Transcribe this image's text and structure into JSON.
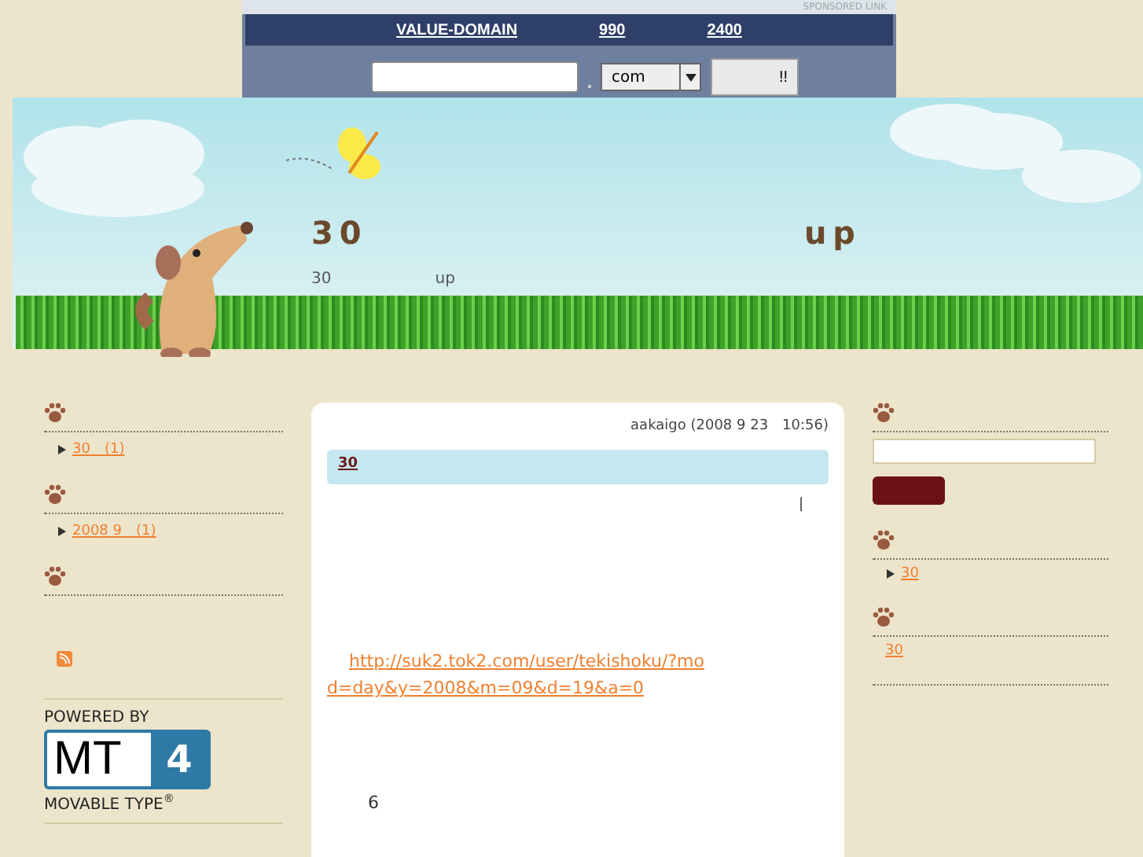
{
  "sponsor": {
    "label": "SPONSORED LINK",
    "headline": [
      "VALUE-DOMAIN",
      "990",
      "2400"
    ],
    "tld": "com",
    "button": "!!"
  },
  "header": {
    "title": [
      "30",
      "up"
    ],
    "subtitle": [
      "30",
      "up"
    ]
  },
  "left_sidebar": [
    {
      "kind": "list",
      "items": [
        "30　(1)"
      ]
    },
    {
      "kind": "list",
      "items": [
        "2008 9　(1)"
      ]
    },
    {
      "kind": "feed"
    }
  ],
  "powered_by": {
    "top": "POWERED BY",
    "mark": "MT",
    "version": "4",
    "bottom": "MOVABLE TYPE",
    "reg": "®"
  },
  "entry": {
    "meta": "aakaigo (2008 9 23　10:56)",
    "title": "30",
    "separator": "|",
    "link": "http://suk2.tok2.com/user/tekishoku/?mod=day&y=2008&m=09&d=19&a=0",
    "footer_text": "6"
  },
  "right_sidebar": [
    {
      "kind": "search"
    },
    {
      "kind": "list",
      "items": [
        "30"
      ]
    },
    {
      "kind": "links",
      "items": [
        "30"
      ]
    }
  ]
}
